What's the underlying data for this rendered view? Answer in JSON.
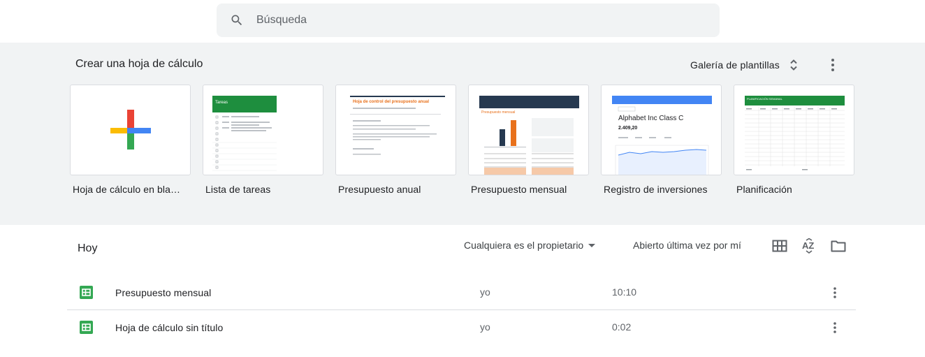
{
  "search": {
    "placeholder": "Búsqueda",
    "value": ""
  },
  "gallery": {
    "title": "Crear una hoja de cálculo",
    "gallery_button": "Galería de plantillas",
    "templates": [
      {
        "name": "Hoja de cálculo en blanco"
      },
      {
        "name": "Lista de tareas",
        "thumb_header": "Tareas"
      },
      {
        "name": "Presupuesto anual",
        "thumb_title": "Hoja de control del presupuesto anual"
      },
      {
        "name": "Presupuesto mensual",
        "thumb_title": "Presupuesto mensual"
      },
      {
        "name": "Registro de inversiones",
        "thumb_title": "Alphabet Inc Class C",
        "thumb_value": "2.409,20"
      },
      {
        "name": "Planificación",
        "thumb_header": "PLANIFICACIÓN SEMANAL"
      }
    ]
  },
  "files": {
    "section_title": "Hoy",
    "owner_filter": "Cualquiera es el propietario",
    "sort_label": "Abierto última vez por mí",
    "items": [
      {
        "name": "Presupuesto mensual",
        "owner": "yo",
        "date": "10:10"
      },
      {
        "name": "Hoja de cálculo sin título",
        "owner": "yo",
        "date": "0:02"
      }
    ]
  },
  "colors": {
    "sheets_green": "#34a853",
    "gallery_bg": "#f1f3f4",
    "google_blue": "#4285f4",
    "google_red": "#ea4335",
    "google_yellow": "#fbbc04",
    "budget_orange": "#e8711c",
    "budget_navy": "#263950"
  }
}
